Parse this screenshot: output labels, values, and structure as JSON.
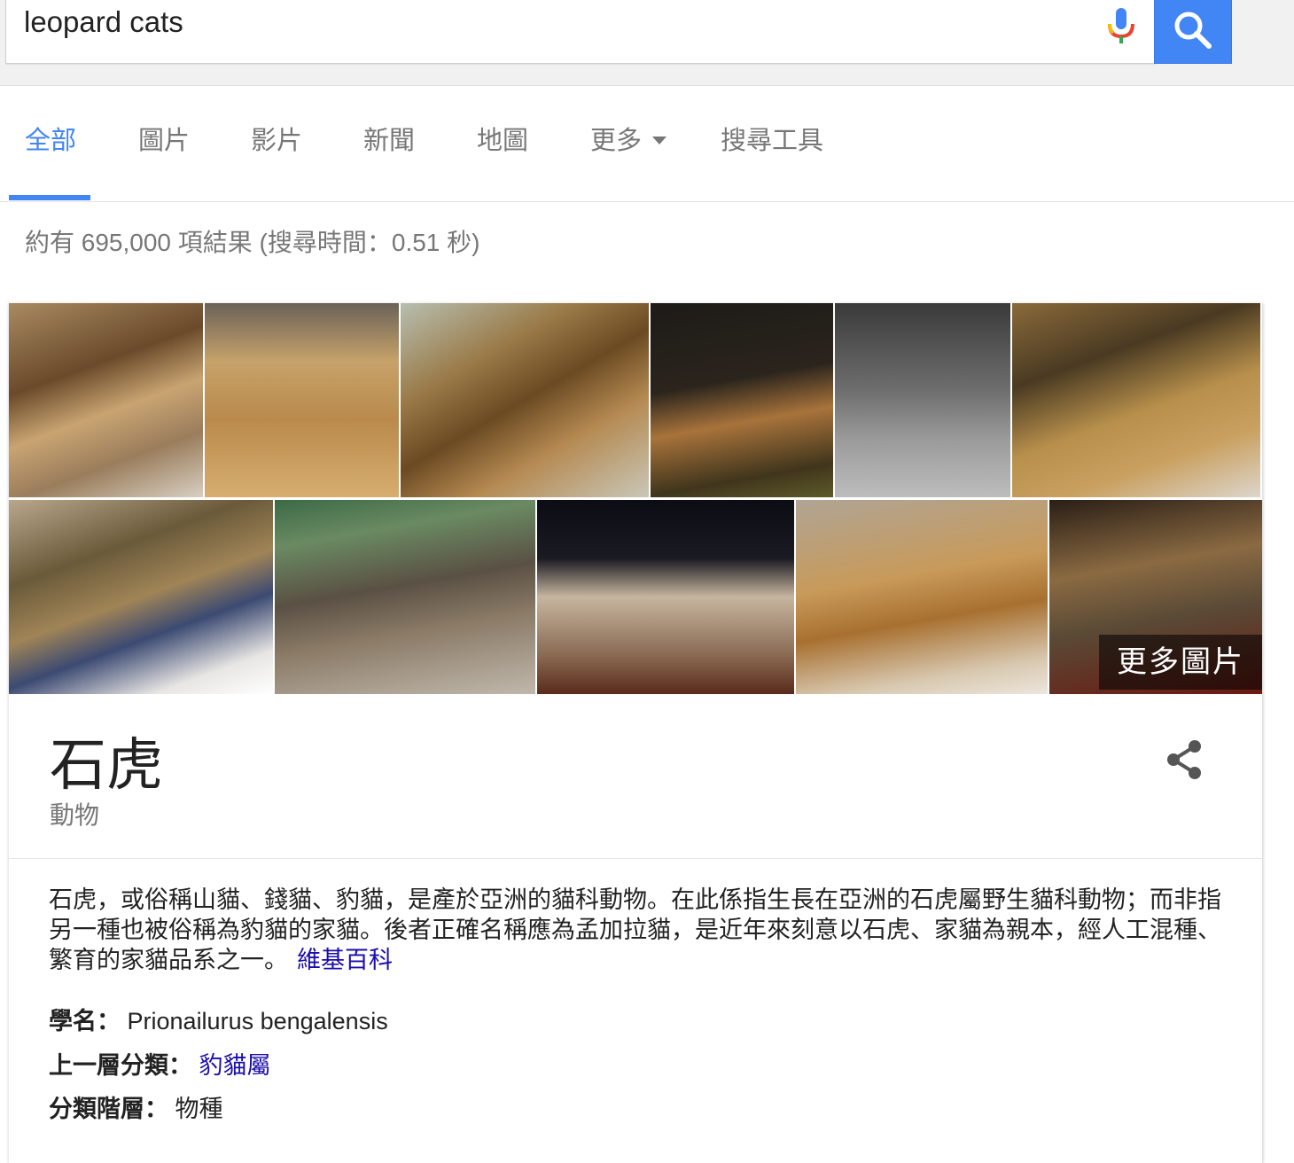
{
  "search": {
    "query": "leopard cats"
  },
  "tabs": [
    {
      "label": "全部"
    },
    {
      "label": "圖片"
    },
    {
      "label": "影片"
    },
    {
      "label": "新聞"
    },
    {
      "label": "地圖"
    },
    {
      "label": "更多"
    },
    {
      "label": "搜尋工具"
    }
  ],
  "colors": {
    "accent": "#4285f4",
    "link": "#1a0dab",
    "muted": "#777777"
  },
  "result_stats": "約有 695,000 項結果 (搜尋時間：0.51 秒)",
  "panel": {
    "more_images_label": "更多圖片",
    "title": "石虎",
    "subtitle": "動物",
    "description": "石虎，或俗稱山貓、錢貓、豹貓，是產於亞洲的貓科動物。在此係指生長在亞洲的石虎屬野生貓科動物；而非指另一種也被俗稱為豹貓的家貓。後者正確名稱應為孟加拉貓，是近年來刻意以石虎、家貓為親本，經人工混種、繁育的家貓品系之一。",
    "source_link": "維基百科",
    "facts": [
      {
        "key": "學名：",
        "value": "Prionailurus bengalensis"
      },
      {
        "key": "上一層分類：",
        "value": "豹貓屬"
      },
      {
        "key": "分類階層：",
        "value": "物種"
      }
    ]
  },
  "icons": {
    "mic": "mic-icon",
    "search": "search-icon",
    "share": "share-icon",
    "more": "caret-down-icon"
  }
}
